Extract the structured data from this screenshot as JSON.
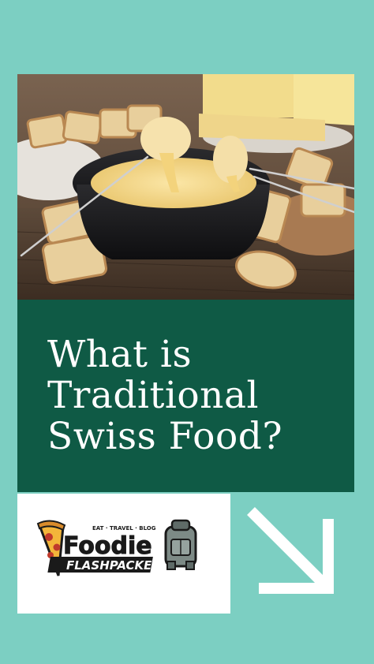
{
  "title": {
    "line1": "What is",
    "line2": "Traditional",
    "line3": "Swiss Food?"
  },
  "logo": {
    "tagline": "EAT · TRAVEL · BLOG",
    "word1": "Foodie",
    "word2": "FLASHPACKER"
  },
  "colors": {
    "background": "#7ccfc2",
    "title_block": "#0f5a45",
    "title_text": "#ffffff",
    "arrow": "#ffffff",
    "logo_dark": "#1a1a1a",
    "logo_accent": "#e0752b"
  },
  "icons": {
    "arrow": "arrow-down-right-icon",
    "pizza": "pizza-icon",
    "backpack": "backpack-icon"
  }
}
